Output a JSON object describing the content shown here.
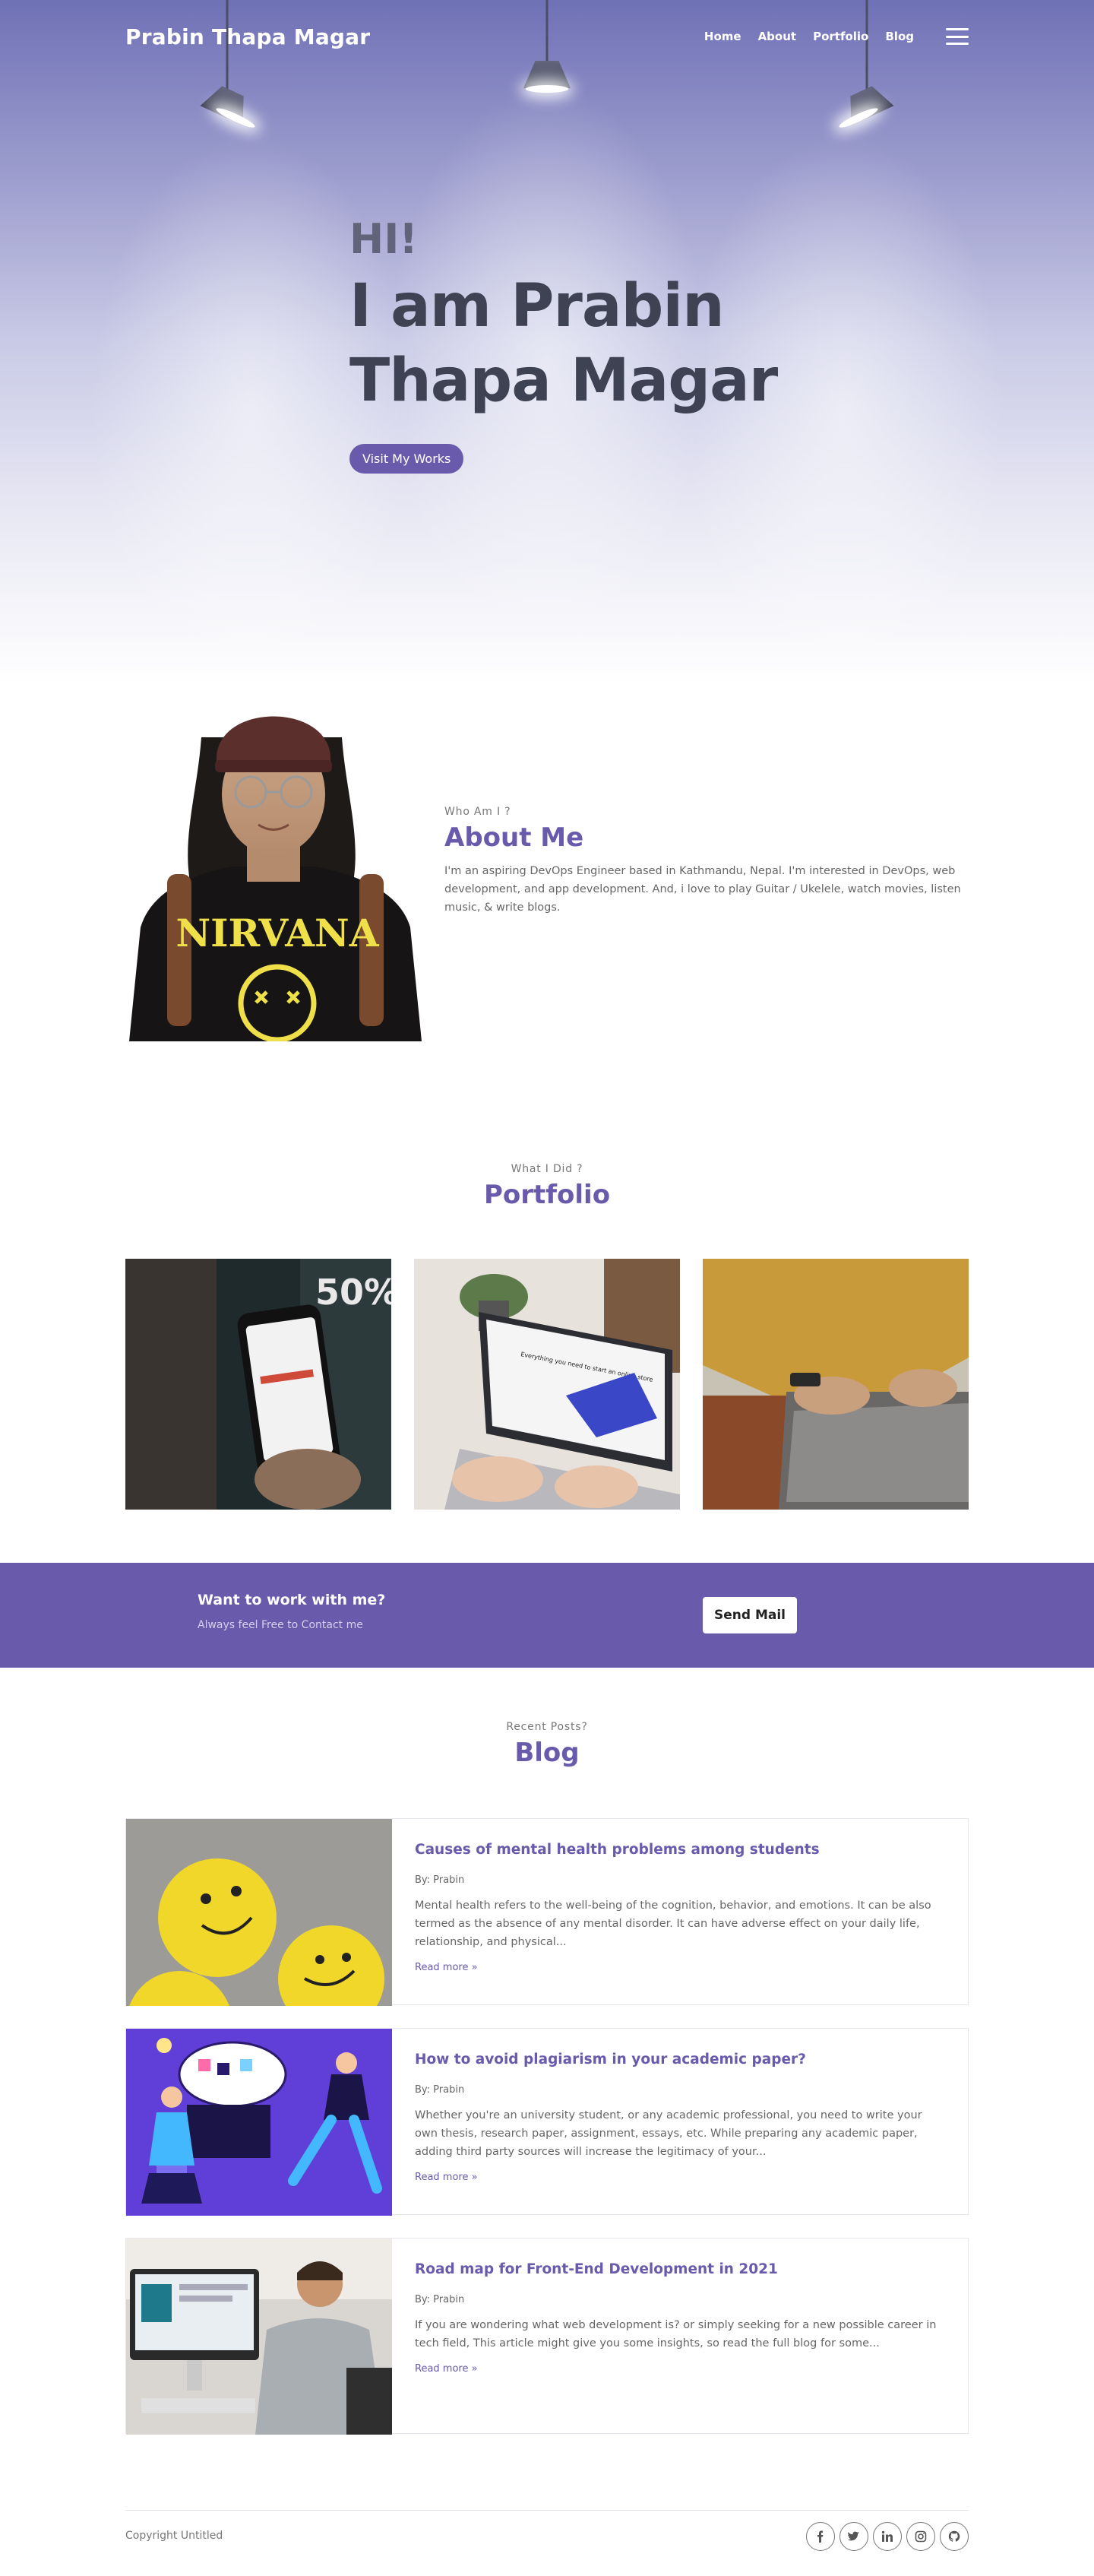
{
  "nav": {
    "brand": "Prabin Thapa Magar",
    "links": [
      "Home",
      "About",
      "Portfolio",
      "Blog"
    ],
    "menu_icon": "hamburger-icon"
  },
  "hero": {
    "greeting": "HI!",
    "headline_line1": "I am Prabin",
    "headline_line2": "Thapa Magar",
    "cta_label": "Visit My Works"
  },
  "about": {
    "eyebrow": "Who Am I ?",
    "title": "About Me",
    "body": "I'm an aspiring DevOps Engineer based in Kathmandu, Nepal. I'm interested in DevOps, web development, and app development. And, i love to play Guitar / Ukelele, watch movies, listen music, & write blogs.",
    "shirt_text": "NIRVANA"
  },
  "portfolio": {
    "eyebrow": "What I Did ?",
    "title": "Portfolio",
    "items": [
      {
        "badge": "50%"
      },
      {
        "screen_text": "Everything you need to start an online store"
      },
      {}
    ]
  },
  "cta": {
    "title": "Want to work with me?",
    "subtitle": "Always feel Free to Contact me",
    "button": "Send Mail"
  },
  "blog": {
    "eyebrow": "Recent Posts?",
    "title": "Blog",
    "posts": [
      {
        "title": "Causes of mental health problems among students",
        "author": "By: Prabin",
        "excerpt": "Mental health refers to the well-being of the cognition, behavior, and emotions. It can be also termed as the absence of any mental disorder. It can have adverse effect on your daily life, relationship, and physical...",
        "read_more": "Read more »"
      },
      {
        "title": "How to avoid plagiarism in your academic paper?",
        "author": "By: Prabin",
        "excerpt": "Whether you're an university student, or any academic professional, you need to write your own thesis, research paper, assignment, essays, etc. While preparing any academic paper, adding third party sources will increase the legitimacy of your...",
        "read_more": "Read more »"
      },
      {
        "title": "Road map for Front-End Development in 2021",
        "author": "By: Prabin",
        "excerpt": "If you are wondering what web development is? or simply seeking for a new possible career in tech field, This article might give you some insights, so read the full blog for some...",
        "read_more": "Read more »"
      }
    ]
  },
  "footer": {
    "copyright": "Copyright Untitled",
    "social_icons": [
      "facebook-icon",
      "twitter-icon",
      "linkedin-icon",
      "instagram-icon",
      "github-icon"
    ]
  },
  "colors": {
    "accent": "#6a5aab",
    "heading_dark": "#3f4252",
    "hero_top": "#6f71b6"
  }
}
